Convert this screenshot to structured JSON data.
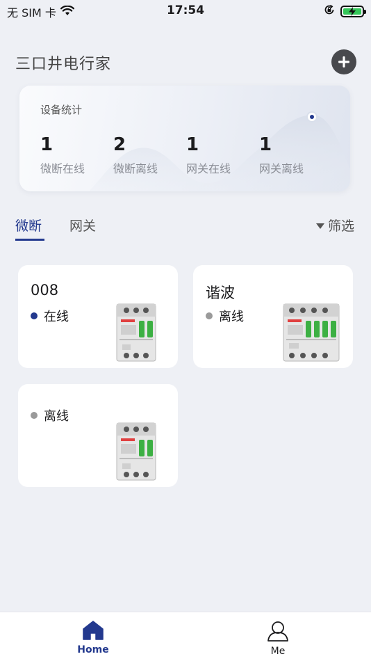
{
  "status_bar": {
    "carrier": "无 SIM 卡",
    "time": "17:54"
  },
  "header": {
    "title": "三口井电行家",
    "add_icon": "plus-circle-icon"
  },
  "stats": {
    "title": "设备统计",
    "items": [
      {
        "value": "1",
        "label": "微断在线"
      },
      {
        "value": "2",
        "label": "微断离线"
      },
      {
        "value": "1",
        "label": "网关在线"
      },
      {
        "value": "1",
        "label": "网关离线"
      }
    ]
  },
  "tabs": [
    {
      "label": "微断",
      "active": true
    },
    {
      "label": "网关",
      "active": false
    }
  ],
  "filter": {
    "label": "筛选"
  },
  "devices": [
    {
      "name": "008",
      "status": "在线",
      "online": true,
      "image": "breaker-2p-icon"
    },
    {
      "name": "谐波",
      "status": "离线",
      "online": false,
      "image": "breaker-4p-icon"
    },
    {
      "name": "",
      "status": "离线",
      "online": false,
      "image": "breaker-2p-icon"
    }
  ],
  "nav": [
    {
      "label": "Home",
      "icon": "home-icon",
      "active": true
    },
    {
      "label": "Me",
      "icon": "person-icon",
      "active": false
    }
  ],
  "colors": {
    "accent": "#23398e",
    "background": "#eef0f5",
    "online": "#23398e",
    "offline": "#9a9a9a",
    "breaker_handle": "#3cb043"
  }
}
